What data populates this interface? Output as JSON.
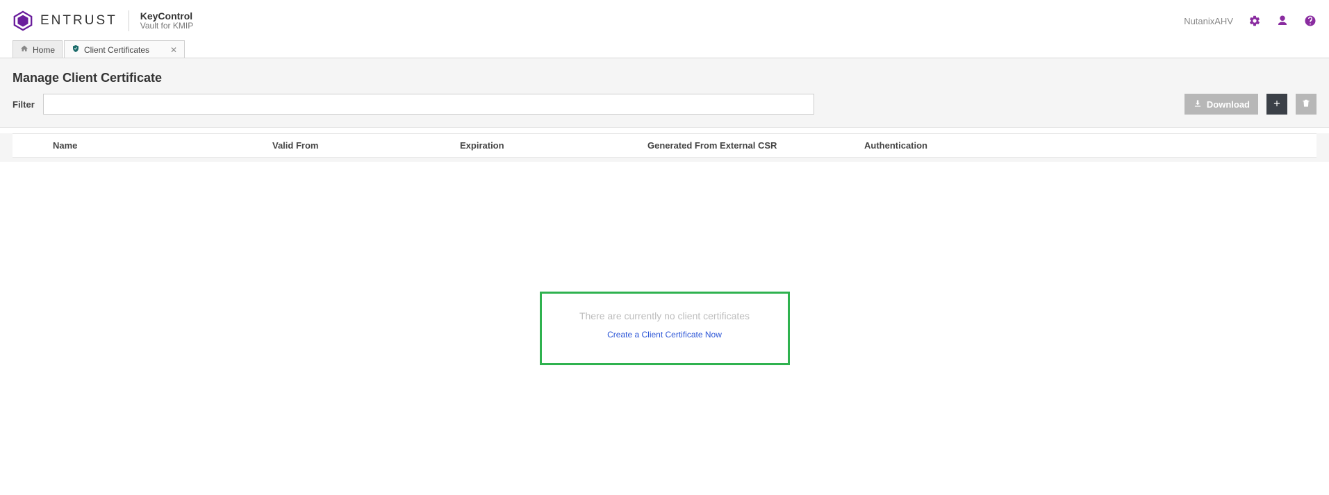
{
  "header": {
    "brand": "ENTRUST",
    "product_name": "KeyControl",
    "product_subtitle": "Vault for KMIP",
    "tenant": "NutanixAHV"
  },
  "tabs": {
    "items": [
      {
        "label": "Home"
      },
      {
        "label": "Client Certificates"
      }
    ]
  },
  "page": {
    "title": "Manage Client Certificate",
    "filter_label": "Filter",
    "filter_value": ""
  },
  "toolbar": {
    "download_label": "Download"
  },
  "table": {
    "columns": {
      "name": "Name",
      "valid_from": "Valid From",
      "expiration": "Expiration",
      "external_csr": "Generated From External CSR",
      "authentication": "Authentication"
    },
    "rows": []
  },
  "empty_state": {
    "message": "There are currently no client certificates",
    "link_label": "Create a Client Certificate Now"
  }
}
